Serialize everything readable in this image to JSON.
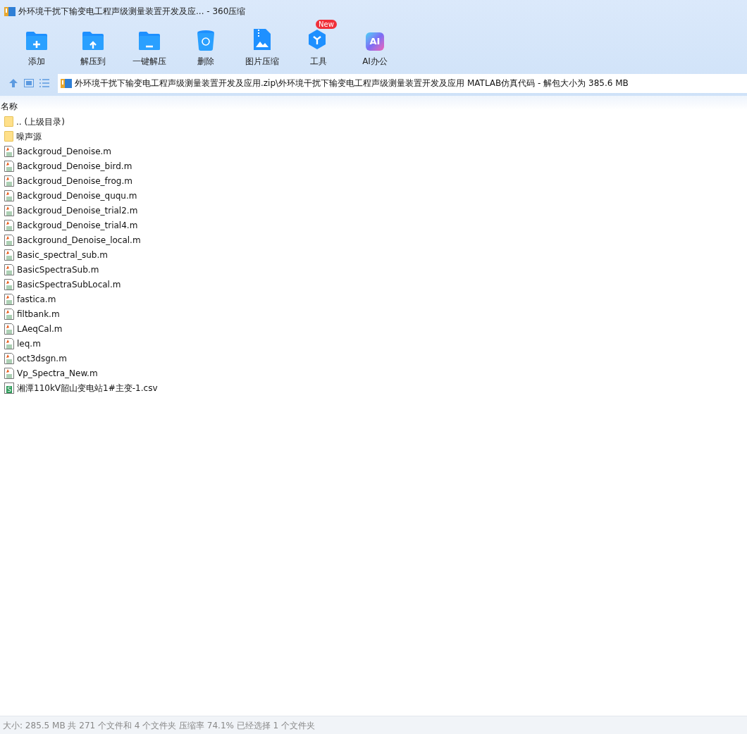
{
  "window": {
    "title": "外环境干扰下输变电工程声级测量装置开发及应... - 360压缩"
  },
  "toolbar": [
    {
      "kind": "add",
      "label": "添加"
    },
    {
      "kind": "extract_to",
      "label": "解压到"
    },
    {
      "kind": "one_click",
      "label": "一键解压"
    },
    {
      "kind": "delete",
      "label": "删除"
    },
    {
      "kind": "image",
      "label": "图片压缩"
    },
    {
      "kind": "tools",
      "label": "工具",
      "badge": "New"
    },
    {
      "kind": "ai",
      "label": "AI办公",
      "icon_text": "AI"
    }
  ],
  "address": {
    "value": "外环境干扰下输变电工程声级测量装置开发及应用.zip\\外环境干扰下输变电工程声级测量装置开发及应用 MATLAB仿真代码 - 解包大小为 385.6 MB"
  },
  "table": {
    "columns": [
      "名称"
    ],
    "rows": [
      {
        "kind": "folder",
        "name": ".. (上级目录)"
      },
      {
        "kind": "folder",
        "name": "噪声源"
      },
      {
        "kind": "matlab",
        "name": "Backgroud_Denoise.m"
      },
      {
        "kind": "matlab",
        "name": "Backgroud_Denoise_bird.m"
      },
      {
        "kind": "matlab",
        "name": "Backgroud_Denoise_frog.m"
      },
      {
        "kind": "matlab",
        "name": "Backgroud_Denoise_ququ.m"
      },
      {
        "kind": "matlab",
        "name": "Backgroud_Denoise_trial2.m"
      },
      {
        "kind": "matlab",
        "name": "Backgroud_Denoise_trial4.m"
      },
      {
        "kind": "matlab",
        "name": "Background_Denoise_local.m"
      },
      {
        "kind": "matlab",
        "name": "Basic_spectral_sub.m"
      },
      {
        "kind": "matlab",
        "name": "BasicSpectraSub.m"
      },
      {
        "kind": "matlab",
        "name": "BasicSpectraSubLocal.m"
      },
      {
        "kind": "matlab",
        "name": "fastica.m"
      },
      {
        "kind": "matlab",
        "name": "filtbank.m"
      },
      {
        "kind": "matlab",
        "name": "LAeqCal.m"
      },
      {
        "kind": "matlab",
        "name": "leq.m"
      },
      {
        "kind": "matlab",
        "name": "oct3dsgn.m"
      },
      {
        "kind": "matlab",
        "name": "Vp_Spectra_New.m"
      },
      {
        "kind": "csv",
        "name": "湘潭110kV韶山变电站1#主变-1.csv",
        "icon_text": "S"
      }
    ]
  },
  "status_bar": "大小: 285.5 MB 共 271 个文件和 4 个文件夹 压缩率 74.1% 已经选择 1 个文件夹"
}
